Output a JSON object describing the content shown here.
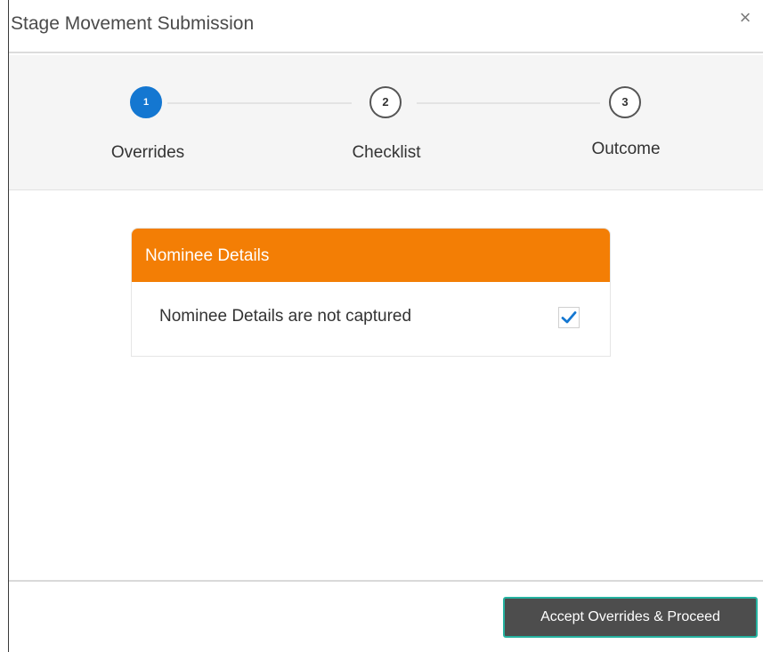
{
  "dialog": {
    "title": "Stage Movement Submission",
    "close_icon": "×"
  },
  "stepper": {
    "steps": [
      {
        "number": "1",
        "label": "Overrides",
        "state": "active"
      },
      {
        "number": "2",
        "label": "Checklist",
        "state": "pending"
      },
      {
        "number": "3",
        "label": "Outcome",
        "state": "pending"
      }
    ]
  },
  "overrides_card": {
    "header": "Nominee Details",
    "override_text": "Nominee Details are not captured",
    "checked": true
  },
  "footer": {
    "accept_label": "Accept Overrides & Proceed"
  },
  "colors": {
    "active_step": "#1477d1",
    "card_header": "#f37e05",
    "button_bg": "#4d4d4d",
    "button_border": "#25b2a0",
    "check": "#1477d1"
  },
  "icons": {
    "close": "close-icon",
    "check": "checkmark-icon"
  }
}
